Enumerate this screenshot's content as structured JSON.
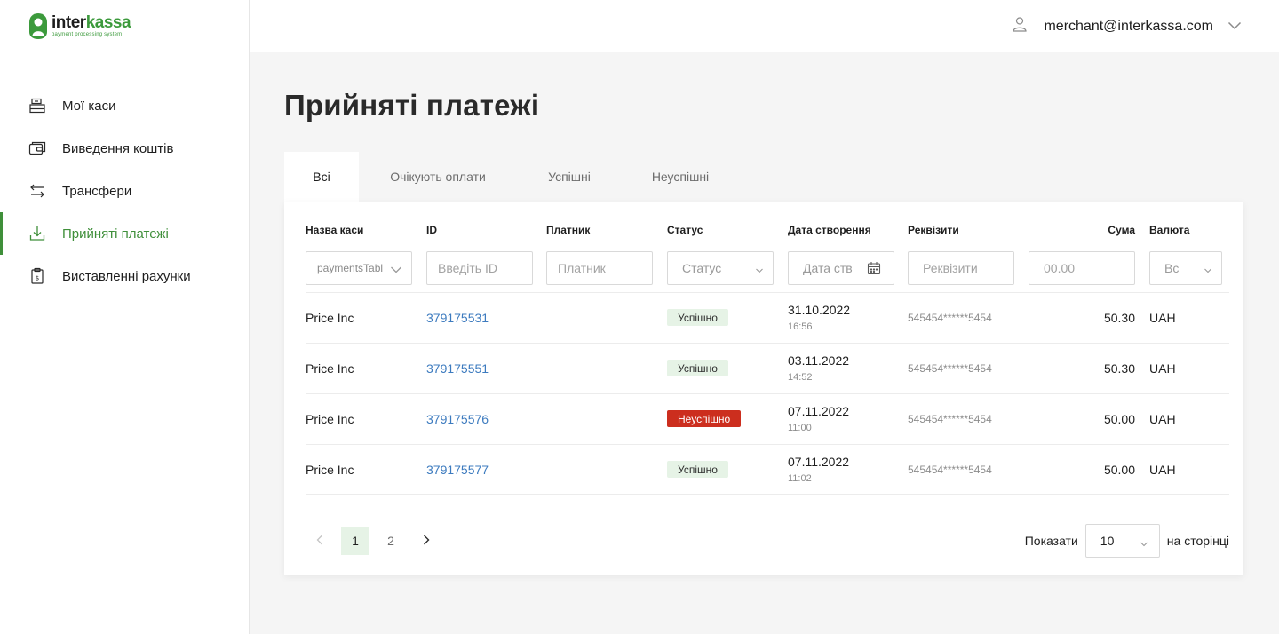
{
  "brand": {
    "name_part1": "inter",
    "name_part2": "kassa",
    "tagline": "payment processing system",
    "accent": "#3f8f3a"
  },
  "header": {
    "user_email": "merchant@interkassa.com"
  },
  "sidebar": {
    "items": [
      {
        "label": "Мої каси",
        "icon": "cashbox-icon",
        "active": false
      },
      {
        "label": "Виведення коштів",
        "icon": "wallet-icon",
        "active": false
      },
      {
        "label": "Трансфери",
        "icon": "transfer-arrows-icon",
        "active": false
      },
      {
        "label": "Прийняті платежі",
        "icon": "download-icon",
        "active": true
      },
      {
        "label": "Виставленні рахунки",
        "icon": "invoice-icon",
        "active": false
      }
    ]
  },
  "main": {
    "title": "Прийняті платежі",
    "tabs": [
      {
        "label": "Всі",
        "active": true
      },
      {
        "label": "Очікують оплати",
        "active": false
      },
      {
        "label": "Успішні",
        "active": false
      },
      {
        "label": "Неуспішні",
        "active": false
      }
    ]
  },
  "table": {
    "columns": [
      "Назва каси",
      "ID",
      "Платник",
      "Статус",
      "Дата створення",
      "Реквізити",
      "Сума",
      "Валюта"
    ],
    "filters": {
      "cashbox_value": "paymentsTable",
      "id_placeholder": "Введіть ID",
      "payer_placeholder": "Платник",
      "status_placeholder": "Статус",
      "date_placeholder": "Дата створення",
      "requisites_placeholder": "Реквізити",
      "sum_placeholder": "00.00",
      "currency_placeholder": "Всі"
    },
    "rows": [
      {
        "cashbox": "Price Inc",
        "id": "379175531",
        "payer": "",
        "status": "Успішно",
        "status_type": "ok",
        "date": "31.10.2022",
        "time": "16:56",
        "requisites": "545454******5454",
        "sum": "50.30",
        "currency": "UAH"
      },
      {
        "cashbox": "Price Inc",
        "id": "379175551",
        "payer": "",
        "status": "Успішно",
        "status_type": "ok",
        "date": "03.11.2022",
        "time": "14:52",
        "requisites": "545454******5454",
        "sum": "50.30",
        "currency": "UAH"
      },
      {
        "cashbox": "Price Inc",
        "id": "379175576",
        "payer": "",
        "status": "Неуспішно",
        "status_type": "fail",
        "date": "07.11.2022",
        "time": "11:00",
        "requisites": "545454******5454",
        "sum": "50.00",
        "currency": "UAH"
      },
      {
        "cashbox": "Price Inc",
        "id": "379175577",
        "payer": "",
        "status": "Успішно",
        "status_type": "ok",
        "date": "07.11.2022",
        "time": "11:02",
        "requisites": "545454******5454",
        "sum": "50.00",
        "currency": "UAH"
      }
    ]
  },
  "pagination": {
    "pages": [
      "1",
      "2"
    ],
    "current_page": "1",
    "show_label": "Показати",
    "per_page": "10",
    "per_page_suffix": "на сторінці"
  }
}
